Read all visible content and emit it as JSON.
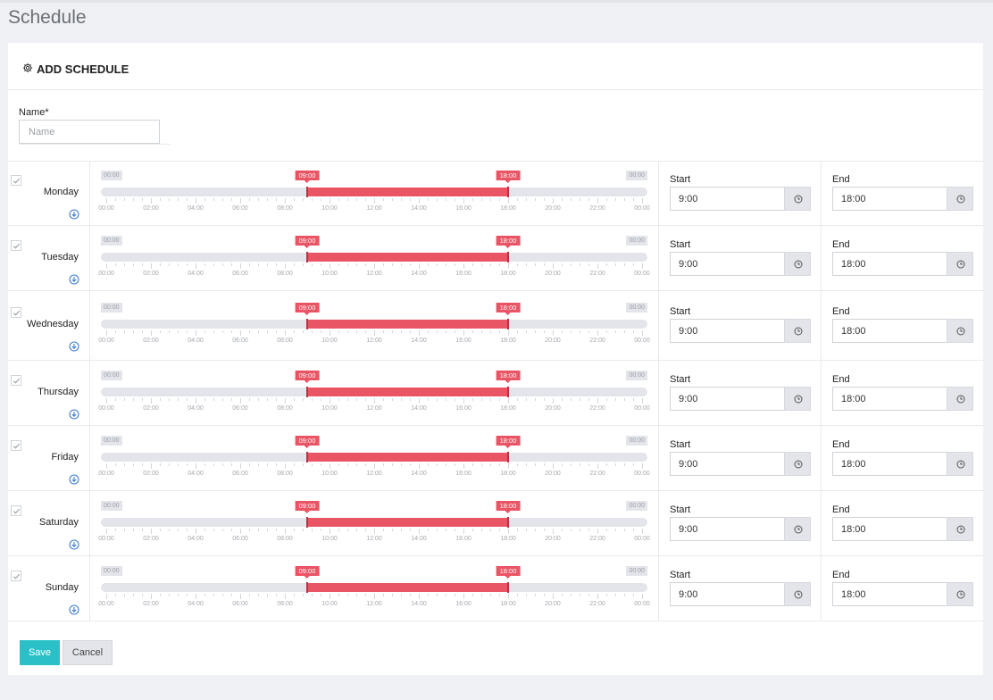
{
  "page": {
    "title": "Schedule"
  },
  "card": {
    "title": "ADD SCHEDULE",
    "icon": "gear-icon"
  },
  "name_field": {
    "label": "Name*",
    "placeholder": "Name",
    "value": ""
  },
  "slider": {
    "range_start_label": "00:00",
    "range_end_label": "00:00",
    "axis_labels": [
      "00:00",
      "02:00",
      "04:00",
      "06:00",
      "08:00",
      "10:00",
      "12:00",
      "14:00",
      "16:00",
      "18:00",
      "20:00",
      "22:00",
      "00:00"
    ]
  },
  "time_block": {
    "start_label": "Start",
    "end_label": "End",
    "picker_icon": "clock-icon"
  },
  "days": [
    {
      "name": "Monday",
      "checked": true,
      "from_label": "09:00",
      "to_label": "18:00",
      "from_hour": 9,
      "to_hour": 18,
      "start": "9:00",
      "end": "18:00"
    },
    {
      "name": "Tuesday",
      "checked": true,
      "from_label": "09:00",
      "to_label": "18:00",
      "from_hour": 9,
      "to_hour": 18,
      "start": "9:00",
      "end": "18:00"
    },
    {
      "name": "Wednesday",
      "checked": true,
      "from_label": "09:00",
      "to_label": "18:00",
      "from_hour": 9,
      "to_hour": 18,
      "start": "9:00",
      "end": "18:00"
    },
    {
      "name": "Thursday",
      "checked": true,
      "from_label": "09:00",
      "to_label": "18:00",
      "from_hour": 9,
      "to_hour": 18,
      "start": "9:00",
      "end": "18:00"
    },
    {
      "name": "Friday",
      "checked": true,
      "from_label": "09:00",
      "to_label": "18:00",
      "from_hour": 9,
      "to_hour": 18,
      "start": "9:00",
      "end": "18:00"
    },
    {
      "name": "Saturday",
      "checked": true,
      "from_label": "09:00",
      "to_label": "18:00",
      "from_hour": 9,
      "to_hour": 18,
      "start": "9:00",
      "end": "18:00"
    },
    {
      "name": "Sunday",
      "checked": true,
      "from_label": "09:00",
      "to_label": "18:00",
      "from_hour": 9,
      "to_hour": 18,
      "start": "9:00",
      "end": "18:00"
    }
  ],
  "actions": {
    "save_label": "Save",
    "cancel_label": "Cancel"
  },
  "colors": {
    "accent": "#ea5565",
    "save": "#2bc0c8",
    "track": "#e3e5ea",
    "background": "#eef0f4"
  }
}
